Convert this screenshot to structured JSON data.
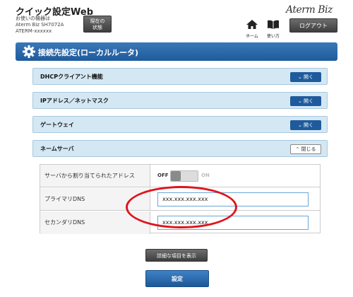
{
  "header": {
    "title": "クイック設定Web",
    "device_caption": "お使いの機器は",
    "device_model": "Aterm Biz SH7072A",
    "device_id": "ATERM-xxxxxx",
    "status_button_line1": "現在の",
    "status_button_line2": "状態",
    "logo": "Aterm Biz",
    "home_label": "ホーム",
    "manual_label": "使い方",
    "logout_label": "ログアウト"
  },
  "section": {
    "title": "接続先設定(ローカルルータ)"
  },
  "accordion": [
    {
      "label": "DHCPクライアント機能",
      "button": "開く",
      "expanded": false
    },
    {
      "label": "IPアドレス／ネットマスク",
      "button": "開く",
      "expanded": false
    },
    {
      "label": "ゲートウェイ",
      "button": "開く",
      "expanded": false
    },
    {
      "label": "ネームサーバ",
      "button": "閉じる",
      "expanded": true
    }
  ],
  "nameserver": {
    "assigned_label": "サーバから割り当てられたアドレス",
    "switch_off": "OFF",
    "switch_on": "ON",
    "primary_label": "プライマリDNS",
    "primary_value": "xxx.xxx.xxx.xxx",
    "secondary_label": "セカンダリDNS",
    "secondary_value": "xxx.xxx.xxx.xxx"
  },
  "buttons": {
    "advanced": "詳細な項目を表示",
    "submit": "設定"
  },
  "colors": {
    "section_header": "#1f5b9c",
    "accordion_bg": "#d4e8f4",
    "annotation": "#e0141c"
  }
}
